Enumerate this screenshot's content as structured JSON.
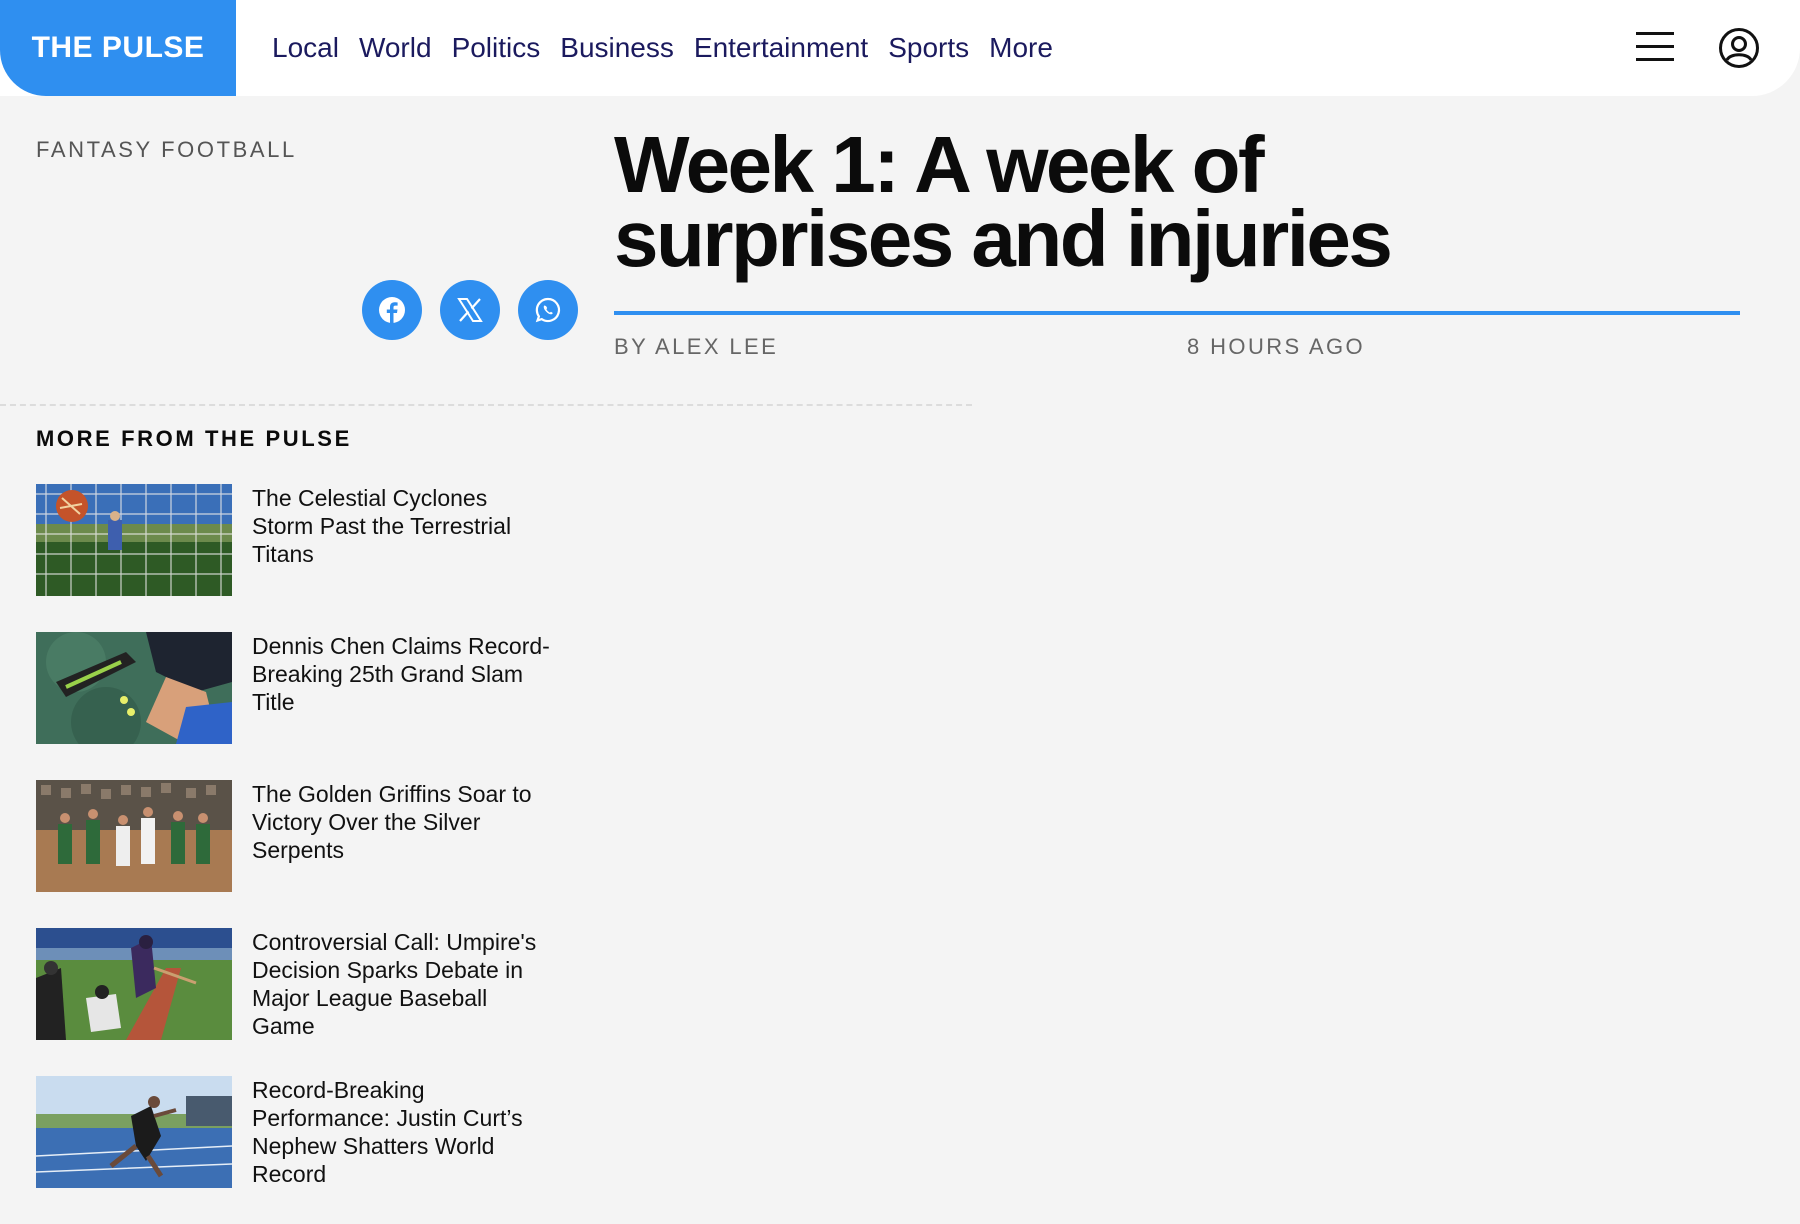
{
  "header": {
    "logo": "THE PULSE",
    "nav": [
      "Local",
      "World",
      "Politics",
      "Business",
      "Entertainment",
      "Sports",
      "More"
    ]
  },
  "article": {
    "category": "FANTASY FOOTBALL",
    "headline_line1": "Week 1: A week of",
    "headline_line2": "surprises and injuries",
    "byline": "BY ALEX LEE",
    "timestamp": "8 HOURS AGO"
  },
  "share": {
    "icons": [
      "facebook-icon",
      "x-icon",
      "whatsapp-icon"
    ]
  },
  "more": {
    "title": "MORE FROM THE PULSE",
    "stories": [
      {
        "title": "The Celestial Cyclones Storm Past the Terrestrial Titans",
        "thumb": "soccer-goal"
      },
      {
        "title": "Dennis Chen Claims Record-Breaking 25th Grand Slam Title",
        "thumb": "tennis"
      },
      {
        "title": "The Golden Griffins Soar to Victory Over the Silver Serpents",
        "thumb": "basketball"
      },
      {
        "title": "Controversial Call: Umpire's Decision Sparks Debate in Major League Baseball Game",
        "thumb": "baseball"
      },
      {
        "title": "Record-Breaking Performance: Justin Curt’s Nephew Shatters World Record",
        "thumb": "sprinter"
      }
    ]
  },
  "colors": {
    "accent": "#2f8ff0",
    "nav_text": "#1b1a5e",
    "background": "#f4f4f4"
  }
}
